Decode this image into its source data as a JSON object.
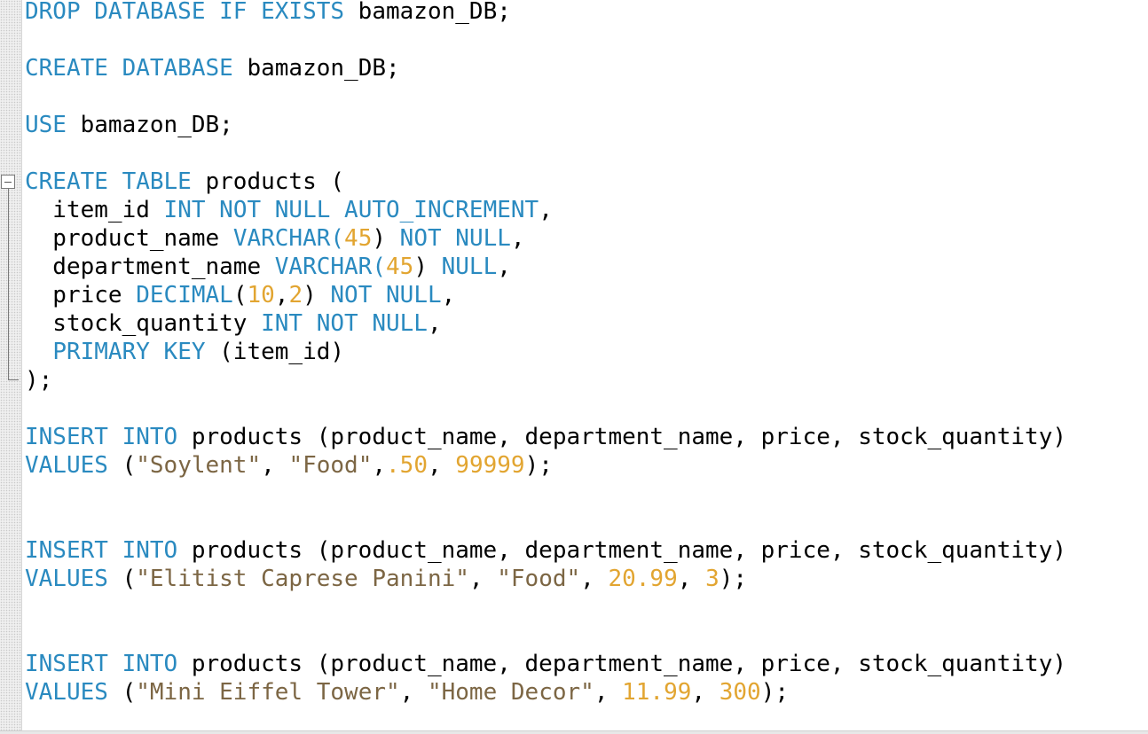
{
  "editor": {
    "language": "SQL",
    "colors": {
      "keyword": "#2a8ac0",
      "string": "#7c6644",
      "number": "#e2a531",
      "text": "#000000",
      "gutter": "#efefef"
    },
    "fold_icon": "collapse-minus-icon",
    "lines": [
      {
        "tokens": [
          {
            "t": "kw",
            "v": "DROP DATABASE IF EXISTS"
          },
          {
            "t": "p",
            "v": " bamazon_DB;"
          }
        ]
      },
      {
        "tokens": [
          {
            "t": "kw",
            "v": "CREATE DATABASE"
          },
          {
            "t": "p",
            "v": " bamazon_DB;"
          }
        ]
      },
      {
        "tokens": [
          {
            "t": "kw",
            "v": "USE"
          },
          {
            "t": "p",
            "v": " bamazon_DB;"
          }
        ]
      },
      {
        "tokens": [
          {
            "t": "kw",
            "v": "CREATE TABLE"
          },
          {
            "t": "p",
            "v": " products ("
          }
        ]
      },
      {
        "tokens": [
          {
            "t": "p",
            "v": "  item_id "
          },
          {
            "t": "kw",
            "v": "INT NOT NULL AUTO_INCREMENT"
          },
          {
            "t": "p",
            "v": ","
          }
        ]
      },
      {
        "tokens": [
          {
            "t": "p",
            "v": "  product_name "
          },
          {
            "t": "kw",
            "v": "VARCHAR("
          },
          {
            "t": "num",
            "v": "45"
          },
          {
            "t": "p",
            "v": ") "
          },
          {
            "t": "kw",
            "v": "NOT NULL"
          },
          {
            "t": "p",
            "v": ","
          }
        ]
      },
      {
        "tokens": [
          {
            "t": "p",
            "v": "  department_name "
          },
          {
            "t": "kw",
            "v": "VARCHAR("
          },
          {
            "t": "num",
            "v": "45"
          },
          {
            "t": "p",
            "v": ") "
          },
          {
            "t": "kw",
            "v": "NULL"
          },
          {
            "t": "p",
            "v": ","
          }
        ]
      },
      {
        "tokens": [
          {
            "t": "p",
            "v": "  price "
          },
          {
            "t": "kw",
            "v": "DECIMAL"
          },
          {
            "t": "p",
            "v": "("
          },
          {
            "t": "num",
            "v": "10"
          },
          {
            "t": "p",
            "v": ","
          },
          {
            "t": "num",
            "v": "2"
          },
          {
            "t": "p",
            "v": ") "
          },
          {
            "t": "kw",
            "v": "NOT NULL"
          },
          {
            "t": "p",
            "v": ","
          }
        ]
      },
      {
        "tokens": [
          {
            "t": "p",
            "v": "  stock_quantity "
          },
          {
            "t": "kw",
            "v": "INT NOT NULL"
          },
          {
            "t": "p",
            "v": ","
          }
        ]
      },
      {
        "tokens": [
          {
            "t": "p",
            "v": "  "
          },
          {
            "t": "kw",
            "v": "PRIMARY KEY"
          },
          {
            "t": "p",
            "v": " (item_id)"
          }
        ]
      },
      {
        "tokens": [
          {
            "t": "p",
            "v": ");"
          }
        ]
      },
      {
        "tokens": [
          {
            "t": "kw",
            "v": "INSERT INTO"
          },
          {
            "t": "p",
            "v": " products (product_name, department_name, price, stock_quantity)"
          }
        ]
      },
      {
        "tokens": [
          {
            "t": "kw",
            "v": "VALUES"
          },
          {
            "t": "p",
            "v": " ("
          },
          {
            "t": "str",
            "v": "\"Soylent\""
          },
          {
            "t": "p",
            "v": ", "
          },
          {
            "t": "str",
            "v": "\"Food\""
          },
          {
            "t": "p",
            "v": ","
          },
          {
            "t": "num",
            "v": ".50"
          },
          {
            "t": "p",
            "v": ", "
          },
          {
            "t": "num",
            "v": "99999"
          },
          {
            "t": "p",
            "v": ");"
          }
        ]
      },
      {
        "tokens": [
          {
            "t": "kw",
            "v": "INSERT INTO"
          },
          {
            "t": "p",
            "v": " products (product_name, department_name, price, stock_quantity)"
          }
        ]
      },
      {
        "tokens": [
          {
            "t": "kw",
            "v": "VALUES"
          },
          {
            "t": "p",
            "v": " ("
          },
          {
            "t": "str",
            "v": "\"Elitist Caprese Panini\""
          },
          {
            "t": "p",
            "v": ", "
          },
          {
            "t": "str",
            "v": "\"Food\""
          },
          {
            "t": "p",
            "v": ", "
          },
          {
            "t": "num",
            "v": "20.99"
          },
          {
            "t": "p",
            "v": ", "
          },
          {
            "t": "num",
            "v": "3"
          },
          {
            "t": "p",
            "v": ");"
          }
        ]
      },
      {
        "tokens": [
          {
            "t": "kw",
            "v": "INSERT INTO"
          },
          {
            "t": "p",
            "v": " products (product_name, department_name, price, stock_quantity)"
          }
        ]
      },
      {
        "tokens": [
          {
            "t": "kw",
            "v": "VALUES"
          },
          {
            "t": "p",
            "v": " ("
          },
          {
            "t": "str",
            "v": "\"Mini Eiffel Tower\""
          },
          {
            "t": "p",
            "v": ", "
          },
          {
            "t": "str",
            "v": "\"Home Decor\""
          },
          {
            "t": "p",
            "v": ", "
          },
          {
            "t": "num",
            "v": "11.99"
          },
          {
            "t": "p",
            "v": ", "
          },
          {
            "t": "num",
            "v": "300"
          },
          {
            "t": "p",
            "v": ");"
          }
        ]
      }
    ]
  }
}
